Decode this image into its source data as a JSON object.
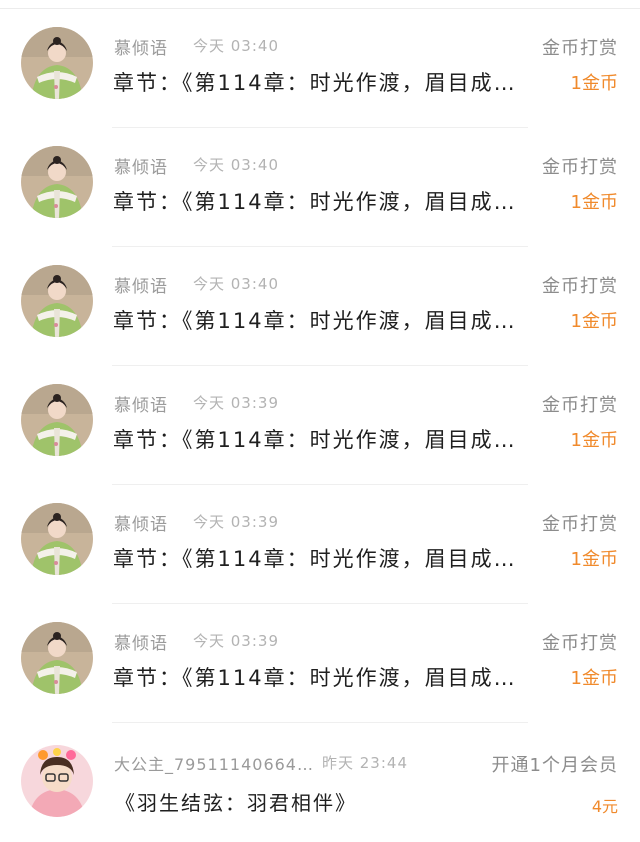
{
  "items": [
    {
      "name": "慕倾语",
      "time": "今天 03:40",
      "type": "金币打赏",
      "content": "章节：《第114章：时光作渡，眉目成…",
      "amount": "1金币"
    },
    {
      "name": "慕倾语",
      "time": "今天 03:40",
      "type": "金币打赏",
      "content": "章节：《第114章：时光作渡，眉目成…",
      "amount": "1金币"
    },
    {
      "name": "慕倾语",
      "time": "今天 03:40",
      "type": "金币打赏",
      "content": "章节：《第114章：时光作渡，眉目成…",
      "amount": "1金币"
    },
    {
      "name": "慕倾语",
      "time": "今天 03:39",
      "type": "金币打赏",
      "content": "章节：《第114章：时光作渡，眉目成…",
      "amount": "1金币"
    },
    {
      "name": "慕倾语",
      "time": "今天 03:39",
      "type": "金币打赏",
      "content": "章节：《第114章：时光作渡，眉目成…",
      "amount": "1金币"
    },
    {
      "name": "慕倾语",
      "time": "今天 03:39",
      "type": "金币打赏",
      "content": "章节：《第114章：时光作渡，眉目成…",
      "amount": "1金币"
    },
    {
      "name": "大公主_79511140664…",
      "time": "昨天 23:44",
      "type": "开通1个月会员",
      "content": "《羽生结弦：羽君相伴》",
      "amount": "4元"
    }
  ],
  "colors": {
    "accent": "#f08a2c",
    "muted": "#9a9a9a"
  }
}
